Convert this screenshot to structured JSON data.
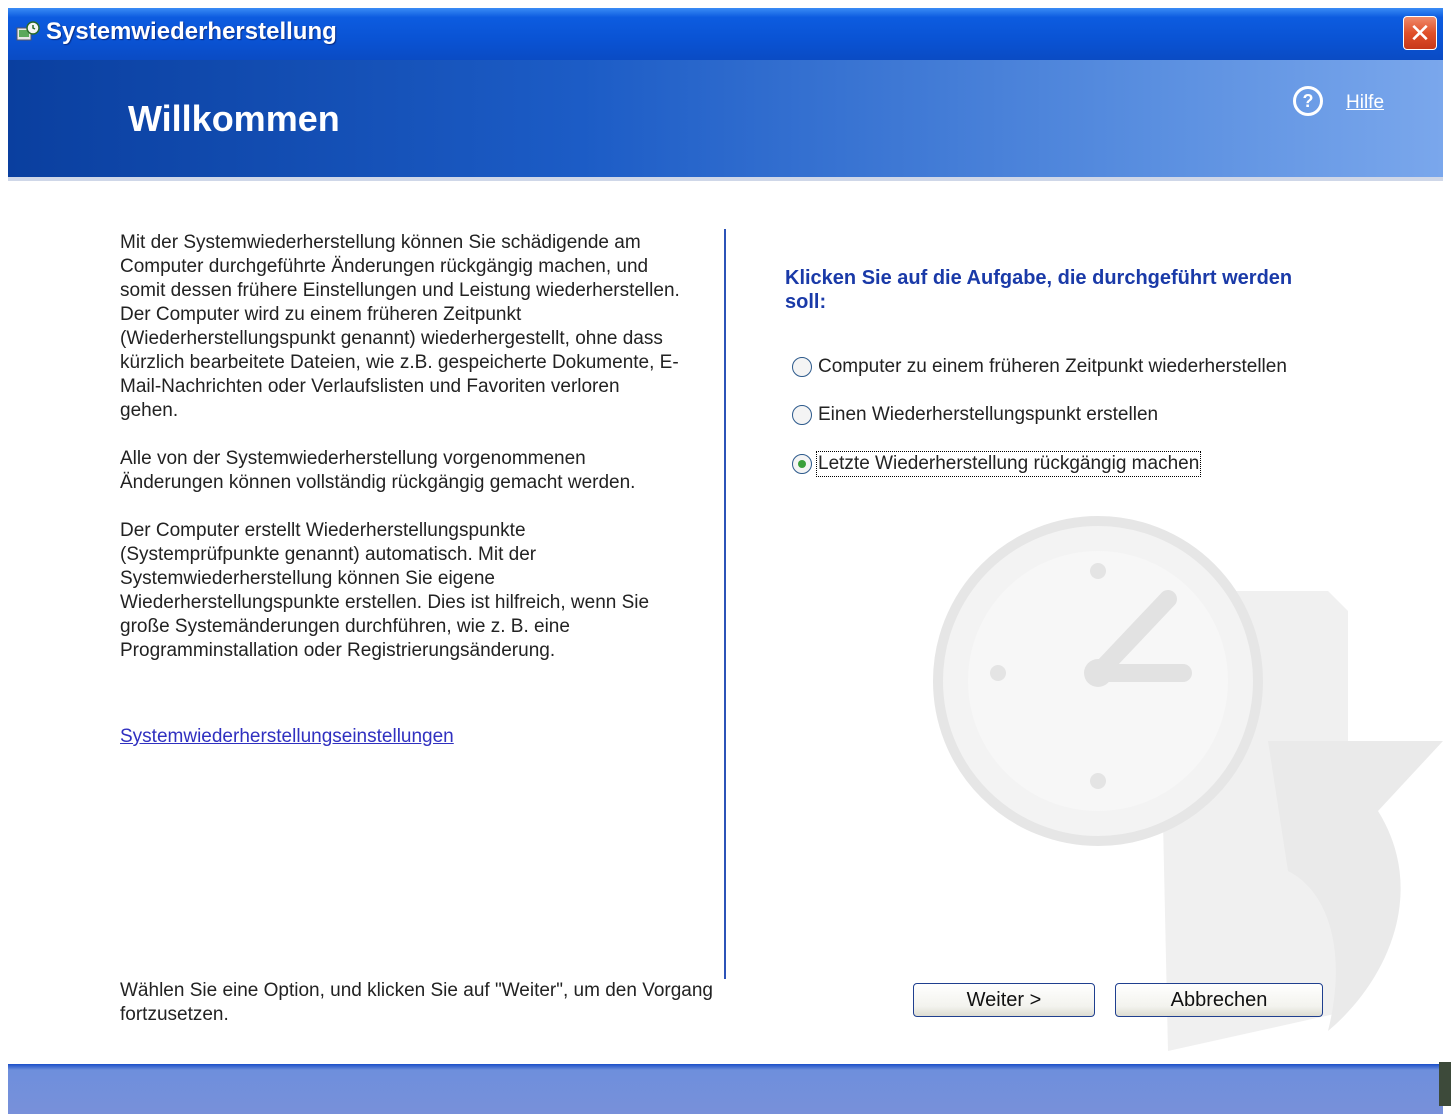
{
  "window": {
    "title": "Systemwiederherstellung",
    "close_symbol": "✕"
  },
  "header": {
    "title": "Willkommen",
    "help_label": "Hilfe",
    "help_symbol": "?"
  },
  "left": {
    "paragraphs": [
      "Mit der Systemwiederherstellung können Sie schädigende am Computer durchgeführte Änderungen rückgängig machen, und somit dessen frühere Einstellungen und Leistung wiederherstellen. Der Computer wird zu einem früheren Zeitpunkt (Wiederherstellungspunkt genannt) wiederhergestellt, ohne dass kürzlich bearbeitete Dateien, wie z.B. gespeicherte Dokumente, E-Mail-Nachrichten oder Verlaufslisten und Favoriten verloren gehen.",
      "Alle von der Systemwiederherstellung vorgenommenen Änderungen können vollständig rückgängig gemacht werden.",
      "Der Computer erstellt Wiederherstellungspunkte (Systemprüfpunkte genannt) automatisch. Mit der Systemwiederherstellung können Sie eigene Wiederherstellungspunkte erstellen. Dies ist hilfreich, wenn Sie große Systemänderungen durchführen, wie z. B. eine Programminstallation oder Registrierungsänderung."
    ],
    "settings_link": "Systemwiederherstellungseinstellungen",
    "bottom_text": "Wählen Sie eine Option, und klicken Sie auf \"Weiter\", um den Vorgang fortzusetzen."
  },
  "right": {
    "prompt": "Klicken Sie auf die Aufgabe, die durchgeführt werden soll:",
    "options": [
      {
        "label": "Computer zu einem früheren Zeitpunkt wiederherstellen",
        "checked": false
      },
      {
        "label": "Einen Wiederherstellungspunkt erstellen",
        "checked": false
      },
      {
        "label": "Letzte Wiederherstellung rückgängig machen",
        "checked": true
      }
    ]
  },
  "buttons": {
    "next": "Weiter >",
    "cancel": "Abbrechen"
  },
  "colors": {
    "titlebar": "#0a53d4",
    "prompt_text": "#1a3aa8",
    "link": "#3030c0",
    "divider": "#2c53b8"
  }
}
